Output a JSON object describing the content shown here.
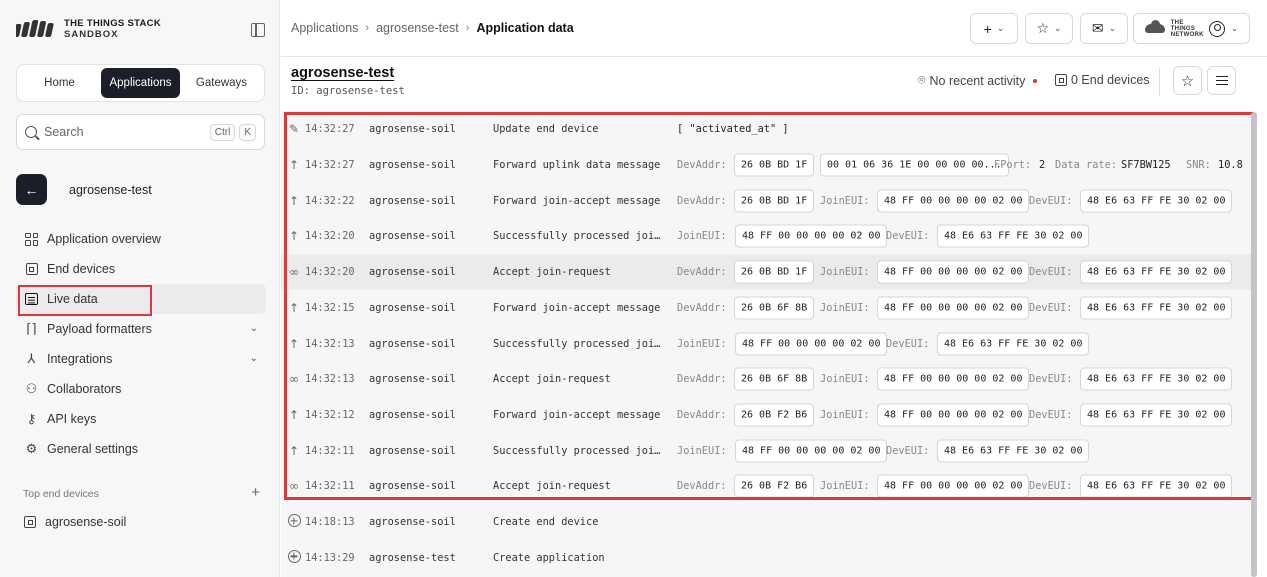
{
  "brand": {
    "line1": "THE THINGS STACK",
    "line2": "SANDBOX"
  },
  "switcher": {
    "home": "Home",
    "applications": "Applications",
    "gateways": "Gateways"
  },
  "search": {
    "placeholder": "Search",
    "key1": "Ctrl",
    "key2": "K"
  },
  "app": {
    "name": "agrosense-test",
    "id_label": "ID:",
    "id": "agrosense-test"
  },
  "nav": {
    "overview": "Application overview",
    "end_devices": "End devices",
    "live_data": "Live data",
    "payload": "Payload formatters",
    "integrations": "Integrations",
    "collaborators": "Collaborators",
    "api_keys": "API keys",
    "settings": "General settings"
  },
  "top_devices": {
    "heading": "Top end devices",
    "item": "agrosense-soil"
  },
  "breadcrumb": {
    "c1": "Applications",
    "c2": "agrosense-test",
    "c3": "Application data"
  },
  "header": {
    "activity": "No recent activity",
    "end_devices": "0 End devices",
    "ttn_logo": "THE THINGS NETWORK"
  },
  "events": [
    {
      "icon": "pencil",
      "time": "14:32:27",
      "device": "agrosense-soil",
      "event": "Update end device",
      "extra": "[ \"activated_at\" ]"
    },
    {
      "icon": "arrow",
      "time": "14:32:27",
      "device": "agrosense-soil",
      "event": "Forward uplink data message",
      "devaddr": "26 0B BD 1F",
      "payload": "00 01 06 36 1E 00 00 00 00...",
      "fport_label": "FPort:",
      "fport": "2",
      "rate_label": "Data rate:",
      "rate": "SF7BW125",
      "snr_label": "SNR:",
      "snr": "10.8"
    },
    {
      "icon": "arrow",
      "time": "14:32:22",
      "device": "agrosense-soil",
      "event": "Forward join-accept message",
      "devaddr": "26 0B BD 1F",
      "joineui": "48 FF 00 00 00 00 02 00",
      "deveui": "48 E6 63 FF FE 30 02 00"
    },
    {
      "icon": "arrow",
      "time": "14:32:20",
      "device": "agrosense-soil",
      "event": "Successfully processed joi…",
      "joineui": "48 FF 00 00 00 00 02 00",
      "deveui": "48 E6 63 FF FE 30 02 00"
    },
    {
      "icon": "join",
      "time": "14:32:20",
      "device": "agrosense-soil",
      "event": "Accept join-request",
      "devaddr": "26 0B BD 1F",
      "joineui": "48 FF 00 00 00 00 02 00",
      "deveui": "48 E6 63 FF FE 30 02 00"
    },
    {
      "icon": "arrow",
      "time": "14:32:15",
      "device": "agrosense-soil",
      "event": "Forward join-accept message",
      "devaddr": "26 0B 6F 8B",
      "joineui": "48 FF 00 00 00 00 02 00",
      "deveui": "48 E6 63 FF FE 30 02 00"
    },
    {
      "icon": "arrow",
      "time": "14:32:13",
      "device": "agrosense-soil",
      "event": "Successfully processed joi…",
      "joineui": "48 FF 00 00 00 00 02 00",
      "deveui": "48 E6 63 FF FE 30 02 00"
    },
    {
      "icon": "join",
      "time": "14:32:13",
      "device": "agrosense-soil",
      "event": "Accept join-request",
      "devaddr": "26 0B 6F 8B",
      "joineui": "48 FF 00 00 00 00 02 00",
      "deveui": "48 E6 63 FF FE 30 02 00"
    },
    {
      "icon": "arrow",
      "time": "14:32:12",
      "device": "agrosense-soil",
      "event": "Forward join-accept message",
      "devaddr": "26 0B F2 B6",
      "joineui": "48 FF 00 00 00 00 02 00",
      "deveui": "48 E6 63 FF FE 30 02 00"
    },
    {
      "icon": "arrow",
      "time": "14:32:11",
      "device": "agrosense-soil",
      "event": "Successfully processed joi…",
      "joineui": "48 FF 00 00 00 00 02 00",
      "deveui": "48 E6 63 FF FE 30 02 00"
    },
    {
      "icon": "join",
      "time": "14:32:11",
      "device": "agrosense-soil",
      "event": "Accept join-request",
      "devaddr": "26 0B F2 B6",
      "joineui": "48 FF 00 00 00 00 02 00",
      "deveui": "48 E6 63 FF FE 30 02 00"
    },
    {
      "icon": "plus",
      "time": "14:18:13",
      "device": "agrosense-soil",
      "event": "Create end device"
    },
    {
      "icon": "plus",
      "time": "14:13:29",
      "device": "agrosense-test",
      "event": "Create application"
    }
  ],
  "labels": {
    "devaddr": "DevAddr:",
    "joineui": "JoinEUI:",
    "deveui": "DevEUI:"
  },
  "colors": {
    "accent_dark": "#1c1f2a",
    "highlight": "#d83a3e",
    "status_dot": "#d83a3e"
  }
}
